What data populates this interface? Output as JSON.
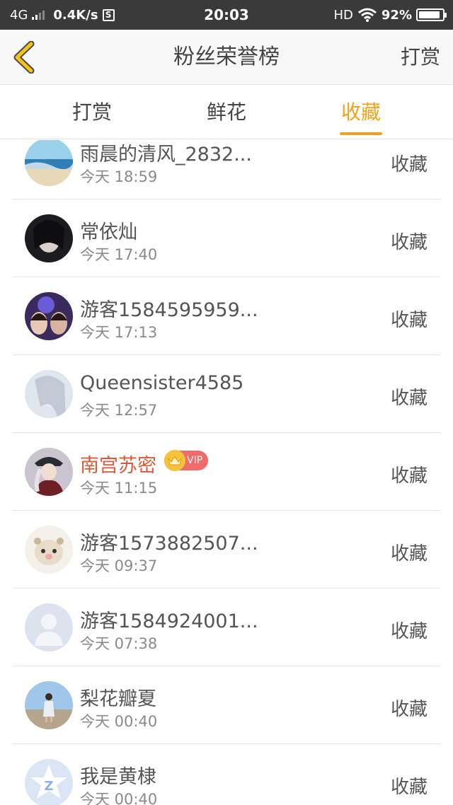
{
  "status_bar": {
    "network": "4G",
    "speed": "0.4K/s",
    "s_icon": "S",
    "time": "20:03",
    "hd": "HD",
    "battery": "92%",
    "battery_level": 0.92
  },
  "header": {
    "title": "粉丝荣誉榜",
    "action": "打赏"
  },
  "tabs": [
    {
      "label": "打赏",
      "active": false
    },
    {
      "label": "鲜花",
      "active": false
    },
    {
      "label": "收藏",
      "active": true
    }
  ],
  "accent_color": "#f0a31a",
  "fans": [
    {
      "name": "雨晨的清风_2832...",
      "time": "今天 18:59",
      "action": "收藏",
      "vip": false
    },
    {
      "name": "常依灿",
      "time": "今天 17:40",
      "action": "收藏",
      "vip": false
    },
    {
      "name": "游客1584595959...",
      "time": "今天 17:13",
      "action": "收藏",
      "vip": false
    },
    {
      "name": "Queensister4585",
      "time": "今天 12:57",
      "action": "收藏",
      "vip": false
    },
    {
      "name": "南宫苏密",
      "time": "今天 11:15",
      "action": "收藏",
      "vip": true,
      "vip_label": "VIP"
    },
    {
      "name": "游客1573882507...",
      "time": "今天 09:37",
      "action": "收藏",
      "vip": false
    },
    {
      "name": "游客1584924001...",
      "time": "今天 07:38",
      "action": "收藏",
      "vip": false
    },
    {
      "name": "梨花瓣夏",
      "time": "今天 00:40",
      "action": "收藏",
      "vip": false
    },
    {
      "name": "我是黄棣",
      "time": "今天 00:40",
      "action": "收藏",
      "vip": false
    }
  ]
}
